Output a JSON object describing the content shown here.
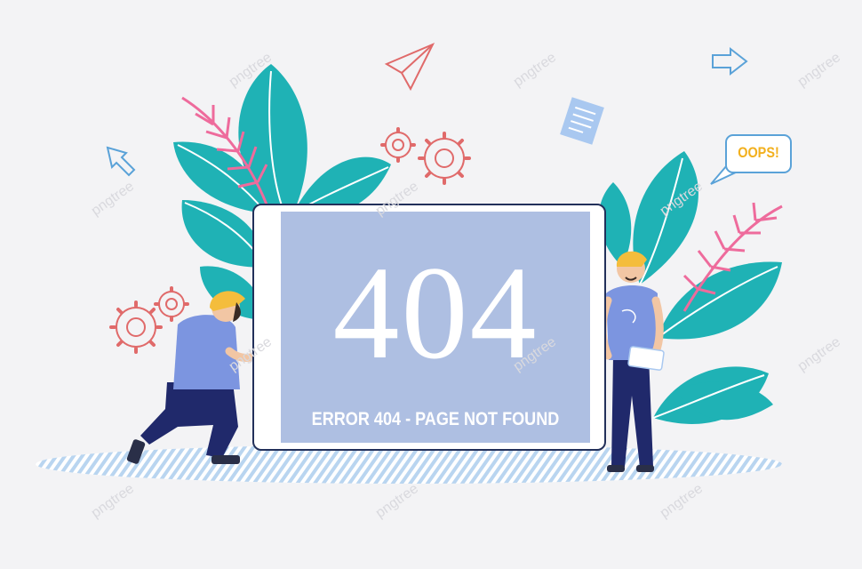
{
  "error": {
    "code": "404",
    "message": "ERROR 404 - PAGE NOT FOUND"
  },
  "speech_bubble": {
    "text": "OOPS!"
  },
  "watermark": {
    "text": "pngtree"
  },
  "colors": {
    "background": "#f3f3f5",
    "panel": "#aebfe2",
    "frame": "#22305a",
    "leaf_teal": "#1fb2b5",
    "fern_pink": "#ee6b9c",
    "shirt_blue": "#7c95e0",
    "pants_navy": "#20296b",
    "helmet_yellow": "#f4bd3c",
    "oops_yellow": "#f2b01e"
  },
  "icons": [
    "paper-plane-icon",
    "arrow-icon",
    "document-icon",
    "gear-icon",
    "wrench-icon",
    "speech-bubble-icon"
  ]
}
